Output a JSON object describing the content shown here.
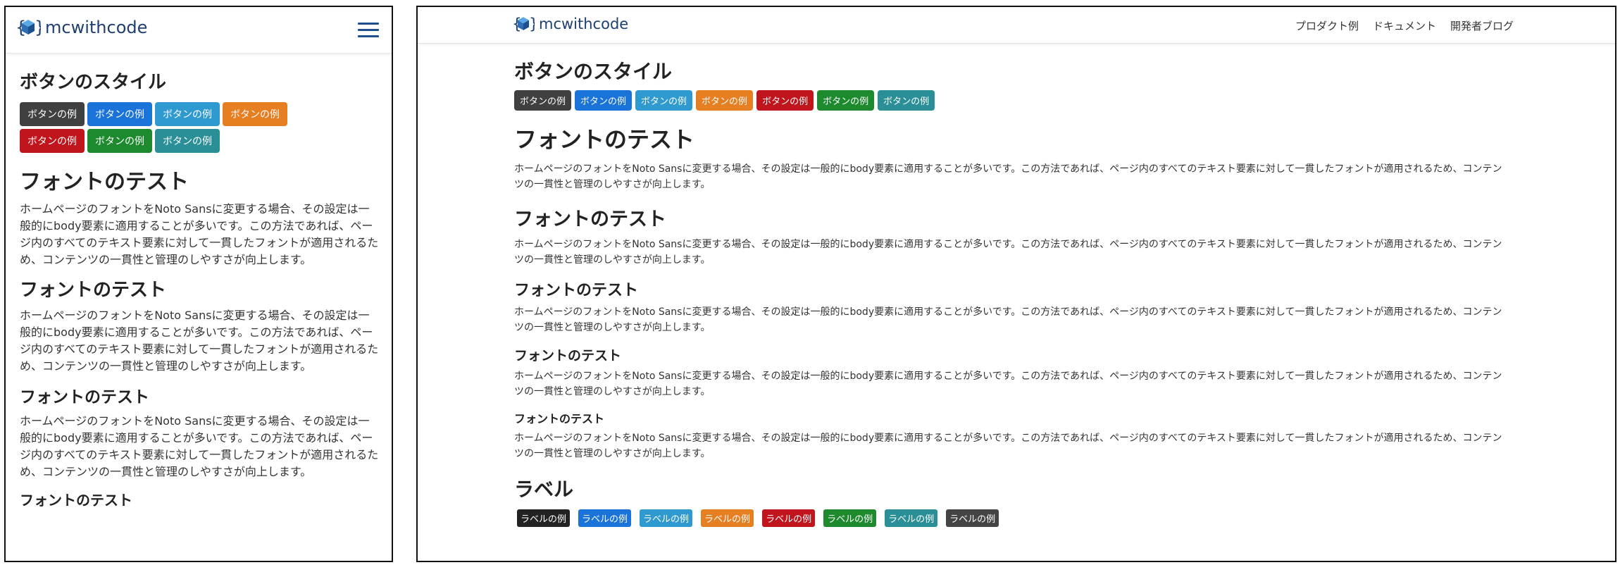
{
  "brand": {
    "name": "mcwithcode"
  },
  "nav": {
    "links": [
      "プロダクト例",
      "ドキュメント",
      "開発者ブログ"
    ]
  },
  "buttons_section": {
    "title": "ボタンのスタイル",
    "buttons": [
      {
        "label": "ボタンの例",
        "color": "#404040"
      },
      {
        "label": "ボタンの例",
        "color": "#1a73d9"
      },
      {
        "label": "ボタンの例",
        "color": "#2e9ad0"
      },
      {
        "label": "ボタンの例",
        "color": "#e67e22"
      },
      {
        "label": "ボタンの例",
        "color": "#c0151c"
      },
      {
        "label": "ボタンの例",
        "color": "#1e8a2e"
      },
      {
        "label": "ボタンの例",
        "color": "#2a8f96"
      }
    ]
  },
  "font_test": {
    "heading": "フォントのテスト",
    "paragraph": "ホームページのフォントをNoto Sansに変更する場合、その設定は一般的にbody要素に適用することが多いです。この方法であれば、ページ内のすべてのテキスト要素に対して一貫したフォントが適用されるため、コンテンツの一貫性と管理のしやすさが向上します。"
  },
  "labels_section": {
    "title": "ラベル",
    "labels": [
      {
        "label": "ラベルの例",
        "color": "#222222"
      },
      {
        "label": "ラベルの例",
        "color": "#1a73d9"
      },
      {
        "label": "ラベルの例",
        "color": "#2e9ad0"
      },
      {
        "label": "ラベルの例",
        "color": "#e67e22"
      },
      {
        "label": "ラベルの例",
        "color": "#c0151c"
      },
      {
        "label": "ラベルの例",
        "color": "#1e8a2e"
      },
      {
        "label": "ラベルの例",
        "color": "#2a8f96"
      },
      {
        "label": "ラベルの例",
        "color": "#444444"
      }
    ]
  }
}
